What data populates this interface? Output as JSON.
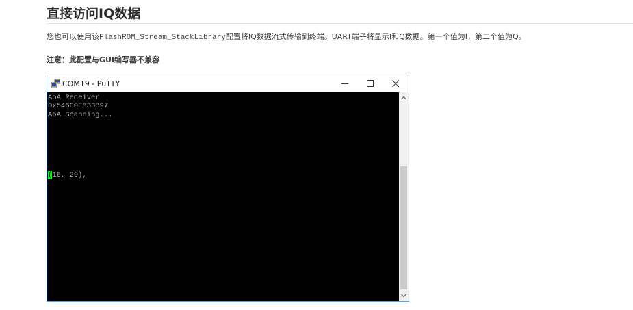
{
  "section": {
    "heading": "直接访问IQ数据",
    "paragraph_before": "您也可以使用该",
    "paragraph_code": "FlashROM_Stream_StackLibrary",
    "paragraph_after": "配置将IQ数据流式传输到终端。UART端子将显示I和Q数据。第一个值为I，第二个值为Q。",
    "note": "注意：此配置与GUI编写器不兼容"
  },
  "putty": {
    "title": "COM19 - PuTTY",
    "icon": "putty-icon",
    "controls": {
      "minimize": "minimize-icon",
      "maximize": "maximize-icon",
      "close": "close-icon"
    },
    "terminal": {
      "lines": [
        "AoA Receiver",
        "0x546C0E833B97",
        "AoA Scanning..."
      ],
      "cursor_char": "(",
      "data_line_rest": "16, 29),"
    },
    "colors": {
      "terminal_bg": "#000000",
      "terminal_text": "#bbbbbb",
      "cursor": "#00ff00",
      "window_border": "#6f9dcc"
    }
  }
}
